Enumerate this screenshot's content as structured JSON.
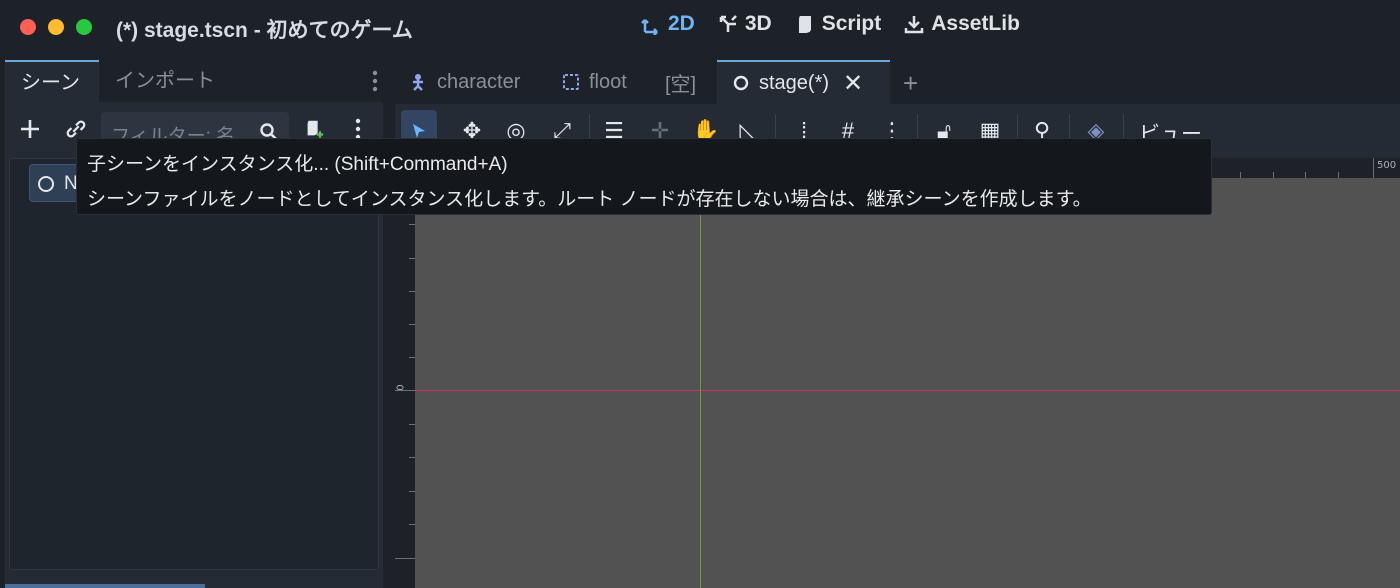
{
  "window": {
    "title": "(*) stage.tscn - 初めてのゲーム",
    "modes": [
      {
        "label": "2D",
        "icon": "2d-icon",
        "active": true
      },
      {
        "label": "3D",
        "icon": "3d-icon",
        "active": false
      },
      {
        "label": "Script",
        "icon": "script-icon",
        "active": false
      },
      {
        "label": "AssetLib",
        "icon": "assetlib-icon",
        "active": false
      }
    ]
  },
  "left_dock": {
    "tabs": [
      "シーン",
      "インポート"
    ],
    "filter_placeholder": "フィルター: 名",
    "tree": {
      "root_label": "N"
    }
  },
  "editor_tabs": [
    {
      "label": "character",
      "icon": "character-icon"
    },
    {
      "label": "floot",
      "icon": "node2d-icon"
    },
    {
      "label": "[空]",
      "icon": ""
    },
    {
      "label": "stage(*)",
      "icon": "node-icon",
      "active": true
    }
  ],
  "toolbar": {
    "view_menu": "ビュー"
  },
  "rulers": {
    "top_label": "500",
    "left_label": "0"
  },
  "tooltip": {
    "title": "子シーンをインスタンス化... (Shift+Command+A)",
    "description": "シーンファイルをノードとしてインスタンス化します。ルート ノードが存在しない場合は、継承シーンを作成します。"
  },
  "colors": {
    "accent": "#6fb4f5",
    "x_axis": "#c8375f",
    "y_axis": "#6e9a3c",
    "viewport_bg": "#525252"
  }
}
